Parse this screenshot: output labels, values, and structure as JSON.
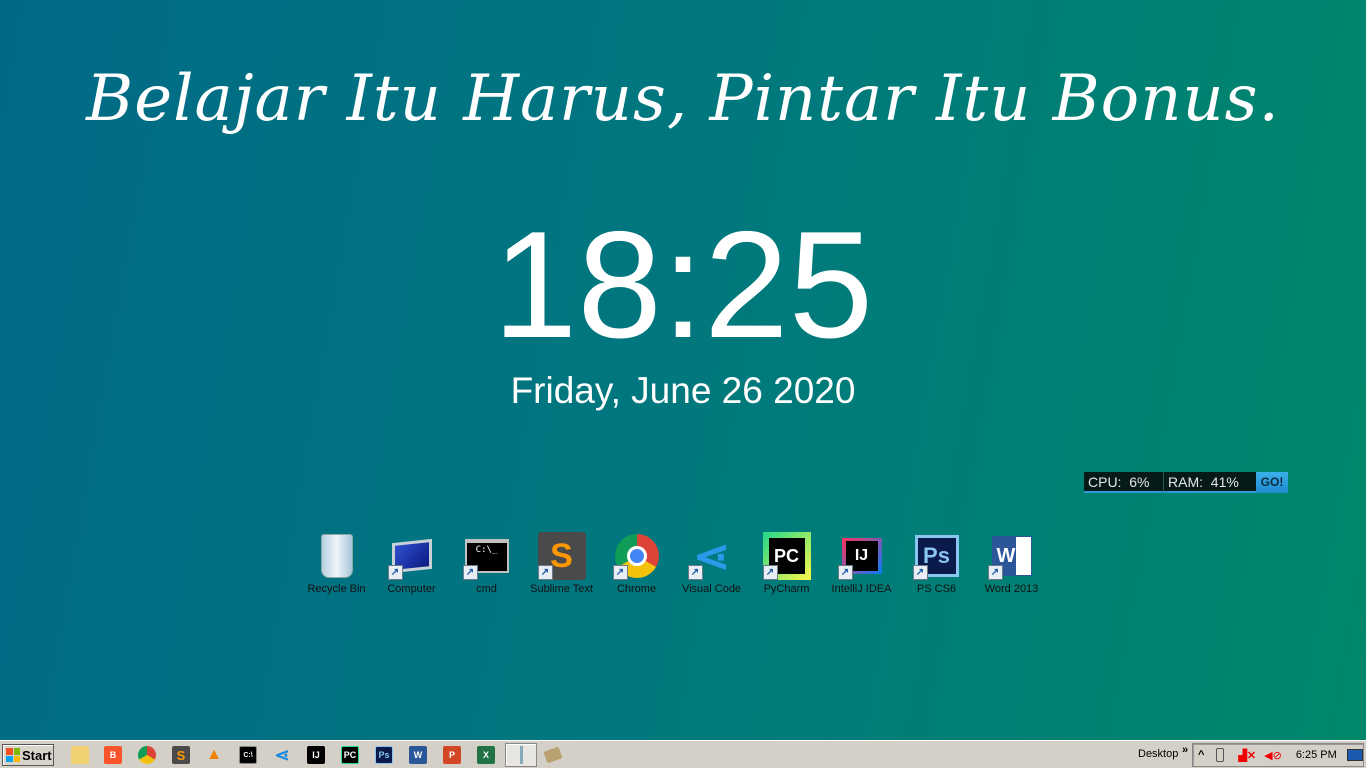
{
  "quote": "Belajar Itu Harus, Pintar Itu Bonus.",
  "clock": "18:25",
  "date": "Friday, June 26 2020",
  "meter": {
    "cpu": "CPU:  6%",
    "ram": "RAM:  41%",
    "go": "GO!"
  },
  "desktop_icons": [
    {
      "label": "Recycle Bin",
      "icon": "recycle-bin-icon"
    },
    {
      "label": "Computer",
      "icon": "computer-icon"
    },
    {
      "label": "cmd",
      "icon": "cmd-icon"
    },
    {
      "label": "Sublime Text",
      "icon": "sublime-text-icon"
    },
    {
      "label": "Chrome",
      "icon": "chrome-icon"
    },
    {
      "label": "Visual Code",
      "icon": "vscode-icon"
    },
    {
      "label": "PyCharm",
      "icon": "pycharm-icon"
    },
    {
      "label": "IntelliJ IDEA",
      "icon": "intellij-icon"
    },
    {
      "label": "PS CS6",
      "icon": "photoshop-icon"
    },
    {
      "label": "Word 2013",
      "icon": "word-icon"
    }
  ],
  "taskbar": {
    "start": "Start",
    "desktop": "Desktop",
    "chevron": "»",
    "tray_expand": "^",
    "time": "6:25 PM"
  },
  "taskbar_icons": [
    "explorer",
    "brave",
    "chrome",
    "sublime",
    "vlc",
    "cmd",
    "vscode",
    "intellij",
    "pycharm",
    "photoshop",
    "word",
    "powerpoint",
    "excel",
    "active-window",
    "book"
  ]
}
